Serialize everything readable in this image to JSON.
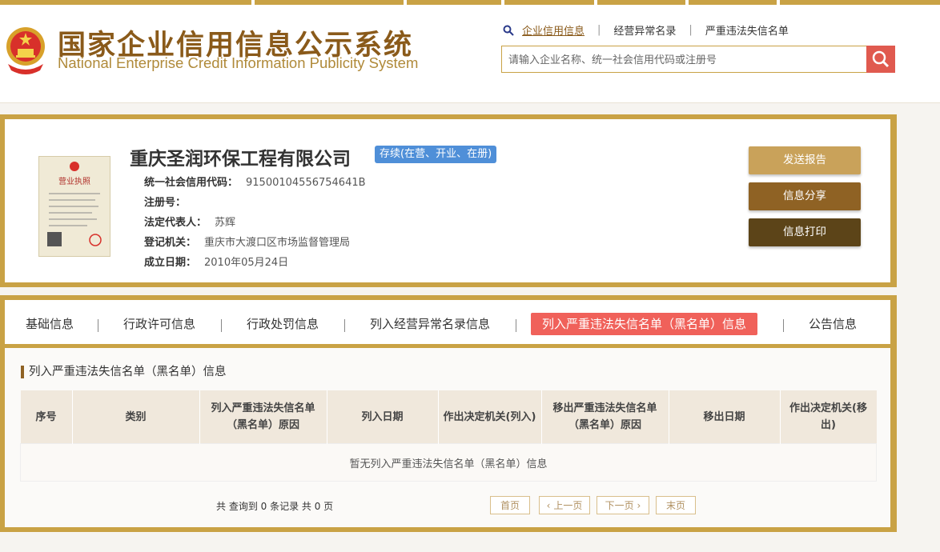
{
  "header": {
    "title_cn": "国家企业信用信息公示系统",
    "title_en": "National Enterprise Credit Information Publicity System",
    "nav": {
      "active": "企业信用信息",
      "item2": "经营异常名录",
      "item3": "严重违法失信名单"
    },
    "search_placeholder": "请输入企业名称、统一社会信用代码或注册号"
  },
  "company": {
    "name": "重庆圣润环保工程有限公司",
    "status": "存续(在营、开业、在册)",
    "licence_label": "营业执照",
    "fields": [
      {
        "label": "统一社会信用代码：",
        "value": "91500104556754641B"
      },
      {
        "label": "注册号：",
        "value": ""
      },
      {
        "label": "法定代表人：",
        "value": "苏辉"
      },
      {
        "label": "登记机关：",
        "value": "重庆市大渡口区市场监督管理局"
      },
      {
        "label": "成立日期：",
        "value": "2010年05月24日"
      }
    ]
  },
  "actions": {
    "send_report": "发送报告",
    "share": "信息分享",
    "print": "信息打印"
  },
  "tabs": [
    "基础信息",
    "行政许可信息",
    "行政处罚信息",
    "列入经营异常名录信息",
    "列入严重违法失信名单（黑名单）信息",
    "公告信息"
  ],
  "section": {
    "title": "列入严重违法失信名单（黑名单）信息",
    "columns": [
      "序号",
      "类别",
      "列入严重违法失信名单（黑名单）原因",
      "列入日期",
      "作出决定机关(列入)",
      "移出严重违法失信名单（黑名单）原因",
      "移出日期",
      "作出决定机关(移出)"
    ],
    "empty_message": "暂无列入严重违法失信名单（黑名单）信息"
  },
  "pager": {
    "summary": "共 查询到 0 条记录 共 0 页",
    "first": "首页",
    "prev": "上一页",
    "next": "下一页",
    "last": "末页"
  },
  "colors": {
    "gold": "#c9a245",
    "brown": "#8f6224",
    "dark_brown": "#5c4418",
    "active_tab": "#f0615a",
    "status_blue": "#4f8fd8",
    "search_red": "#e05a4f"
  },
  "icons": [
    "national-emblem-icon",
    "search-icon",
    "business-licence-image"
  ]
}
